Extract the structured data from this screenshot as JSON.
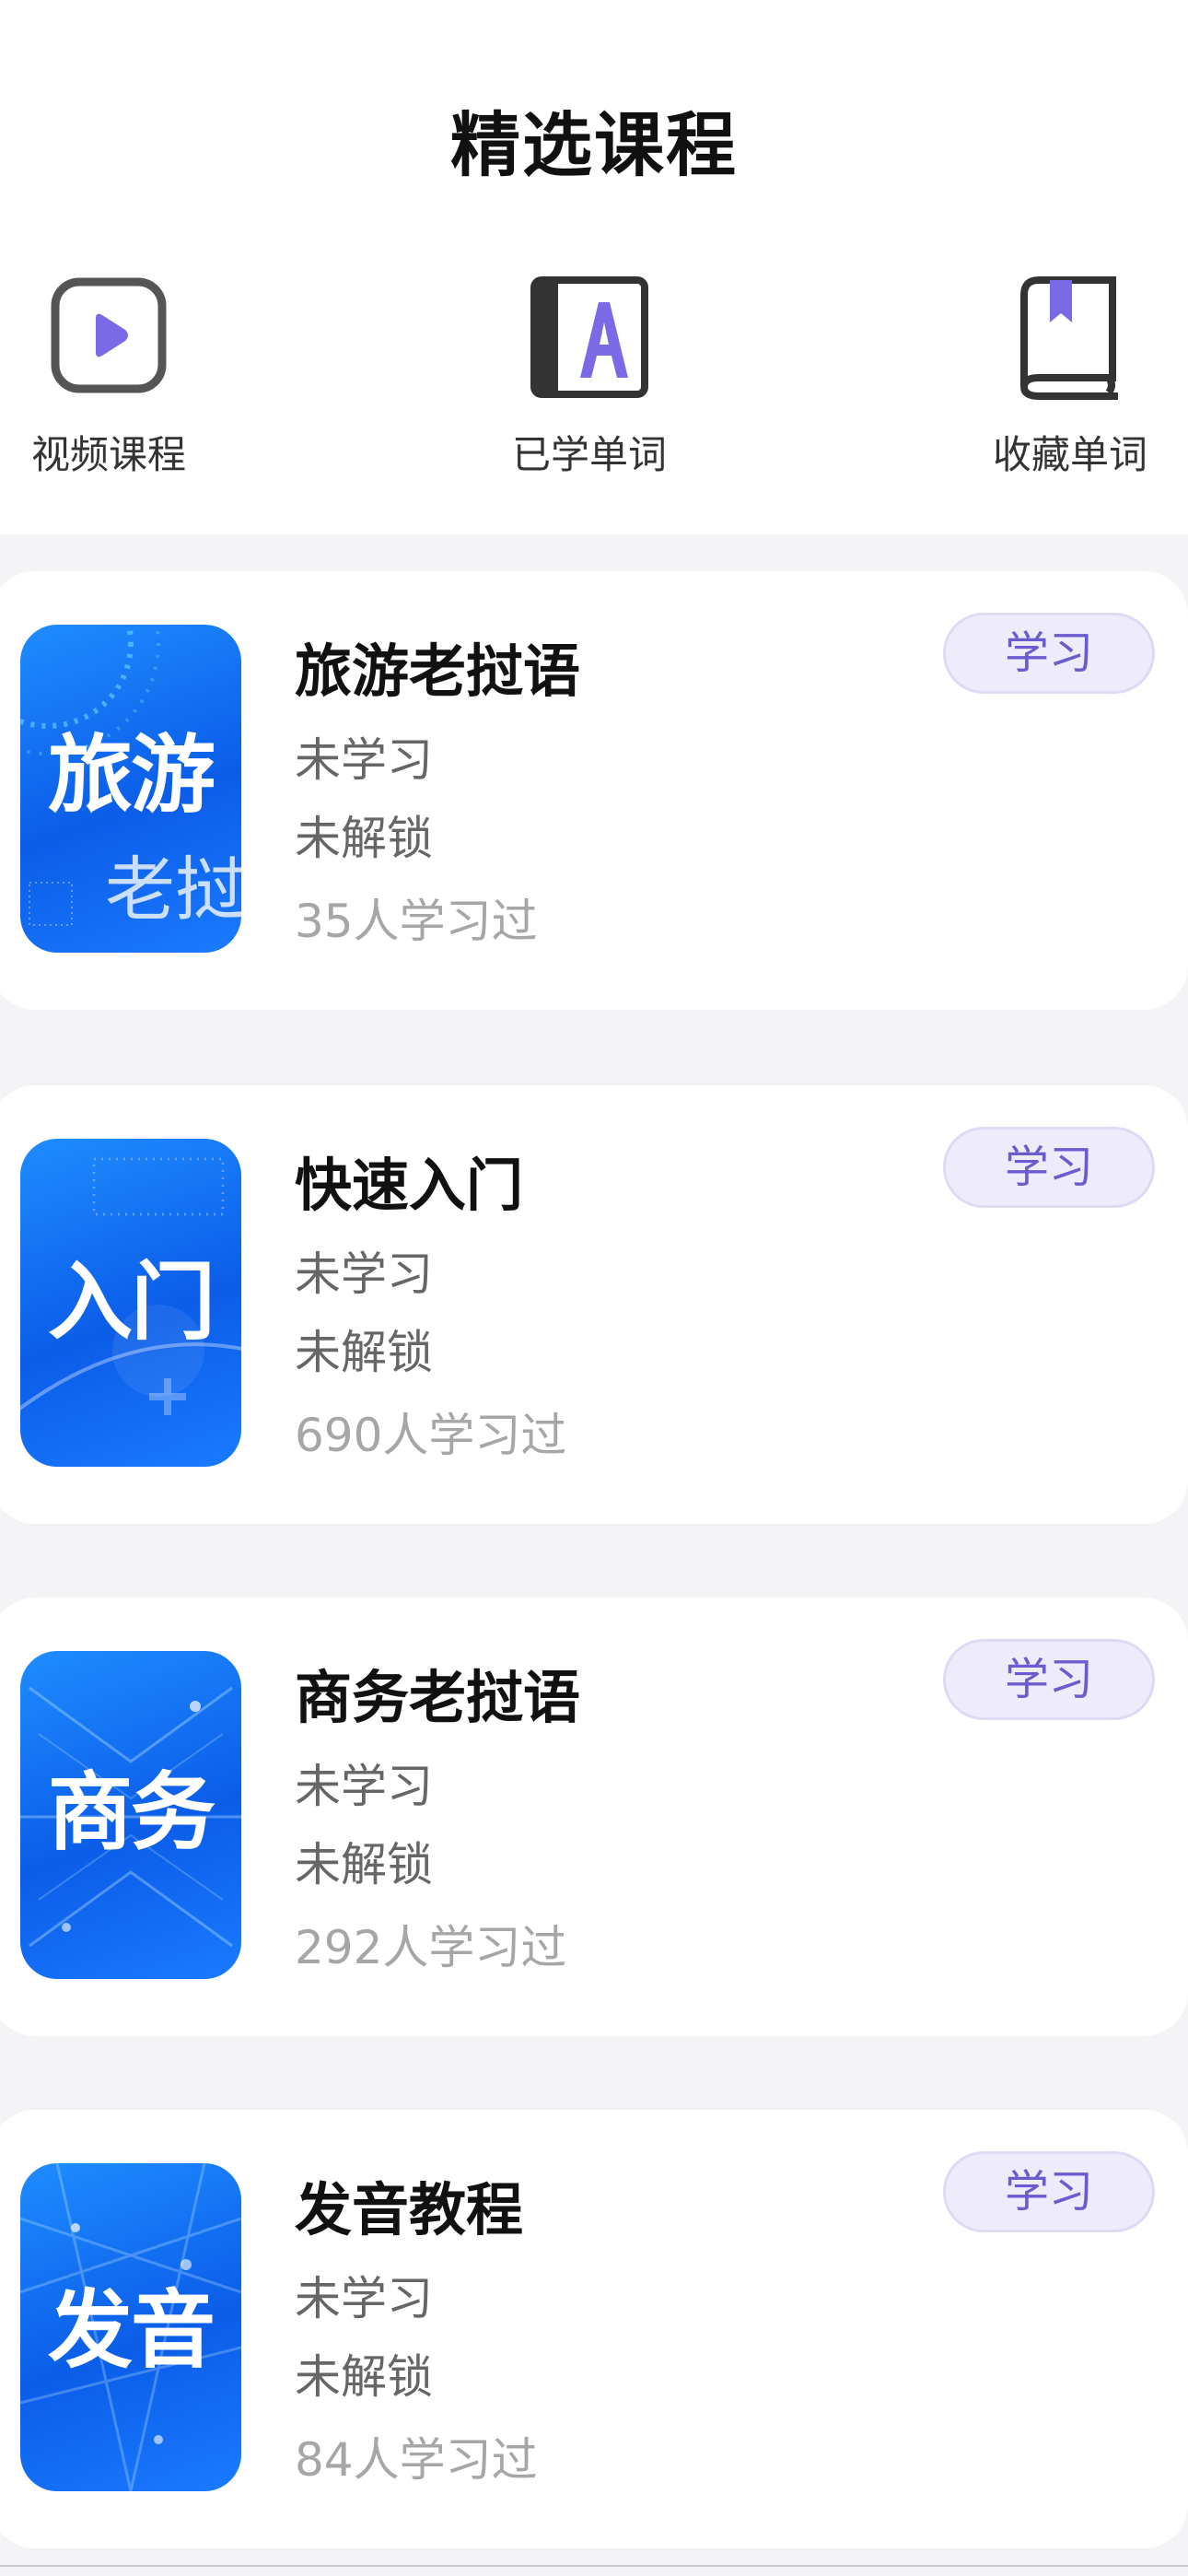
{
  "page": {
    "title": "精选课程"
  },
  "quick_actions": [
    {
      "label": "视频课程",
      "icon": "video-play-icon"
    },
    {
      "label": "已学单词",
      "icon": "letter-a-book-icon"
    },
    {
      "label": "收藏单词",
      "icon": "bookmark-book-icon"
    }
  ],
  "courses": [
    {
      "title": "旅游老挝语",
      "status": "未学习",
      "lock": "未解锁",
      "count": "35人学习过",
      "button": "学习",
      "thumb_text": "旅游",
      "thumb_sub": "老挝"
    },
    {
      "title": "快速入门",
      "status": "未学习",
      "lock": "未解锁",
      "count": "690人学习过",
      "button": "学习",
      "thumb_text": "入门"
    },
    {
      "title": "商务老挝语",
      "status": "未学习",
      "lock": "未解锁",
      "count": "292人学习过",
      "button": "学习",
      "thumb_text": "商务"
    },
    {
      "title": "发音教程",
      "status": "未学习",
      "lock": "未解锁",
      "count": "84人学习过",
      "button": "学习",
      "thumb_text": "发音"
    }
  ],
  "colors": {
    "accent": "#6a5bd0",
    "button_bg": "#eeecfb",
    "thumb_blue": "#0b5de8"
  }
}
